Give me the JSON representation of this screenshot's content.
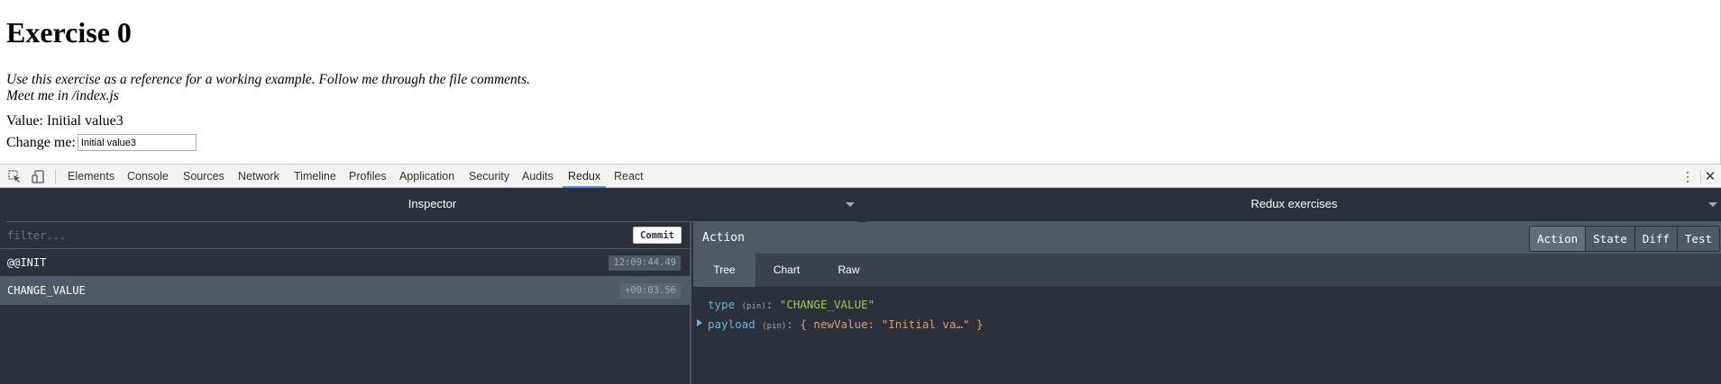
{
  "page": {
    "title": "Exercise 0",
    "intro_line1": "Use this exercise as a reference for a working example. Follow me through the file comments.",
    "intro_line2": "Meet me in /index.js",
    "value_label": "Value: Initial value3",
    "change_label": "Change me:",
    "change_input_value": "Initial value3"
  },
  "devtools": {
    "tabs": [
      "Elements",
      "Console",
      "Sources",
      "Network",
      "Timeline",
      "Profiles",
      "Application",
      "Security",
      "Audits",
      "Redux",
      "React"
    ],
    "active_tab": "Redux",
    "accent_color": "#4a90e2"
  },
  "redux": {
    "left_monitor": "Inspector",
    "right_monitor": "Redux exercises",
    "filter_placeholder": "filter...",
    "commit_label": "Commit",
    "actions": [
      {
        "name": "@@INIT",
        "time": "12:09:44.49"
      },
      {
        "name": "CHANGE_VALUE",
        "time": "+00:03.56"
      }
    ],
    "selected_action": "CHANGE_VALUE",
    "detail_title": "Action",
    "mode_tabs": [
      "Action",
      "State",
      "Diff",
      "Test"
    ],
    "active_mode": "Action",
    "sub_tabs": [
      "Tree",
      "Chart",
      "Raw"
    ],
    "active_sub_tab": "Tree",
    "tree": {
      "type_key": "type",
      "type_value": "\"CHANGE_VALUE\"",
      "payload_key": "payload",
      "payload_value": "{ newValue: \"Initial va…\" }",
      "pin_label": "(pin)"
    },
    "colors": {
      "background": "#2b303b",
      "header": "#4f5a66",
      "key": "#6fb3d2",
      "string": "#a1c659",
      "object": "#d1a37d"
    }
  }
}
